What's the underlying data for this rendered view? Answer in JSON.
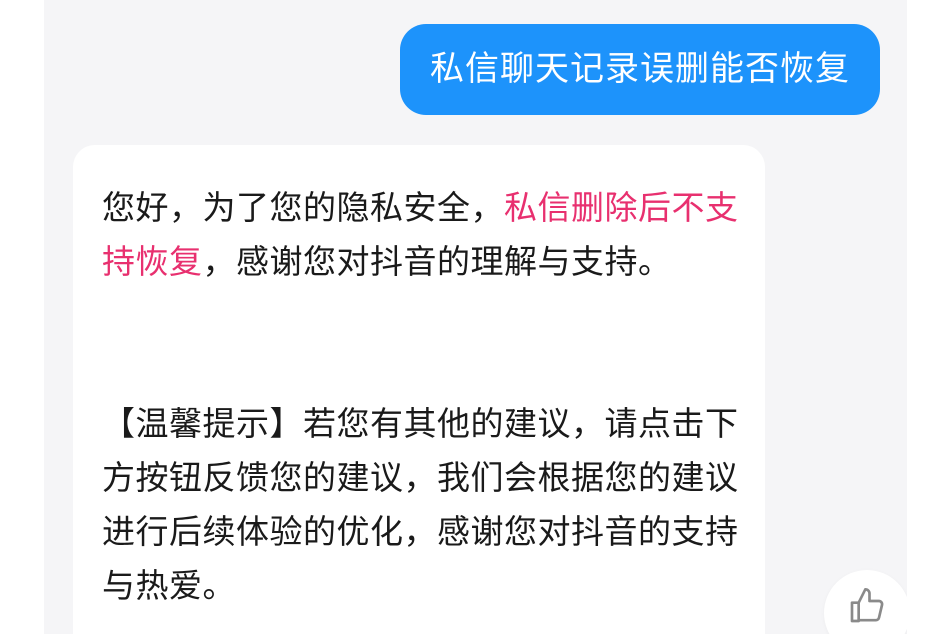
{
  "user_message": {
    "text": "私信聊天记录误删能否恢复"
  },
  "bot_message": {
    "para1_prefix": "您好，为了您的隐私安全，",
    "para1_highlight": "私信删除后不支持恢复",
    "para1_suffix": "，感谢您对抖音的理解与支持。",
    "para2": "【温馨提示】若您有其他的建议，请点击下方按钮反馈您的建议，我们会根据您的建议进行后续体验的优化，感谢您对抖音的支持与热爱。"
  },
  "actions": {
    "like_icon": "thumbs-up-icon"
  },
  "colors": {
    "user_bubble": "#1d93fb",
    "highlight": "#e8306f",
    "chat_background": "#f5f5f7",
    "bot_bubble": "#ffffff"
  }
}
